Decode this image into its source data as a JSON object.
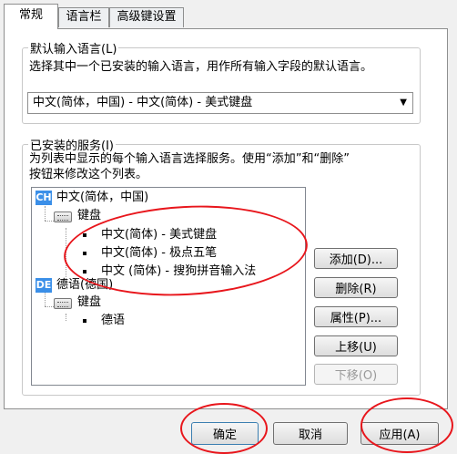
{
  "tabs": [
    {
      "label": "常规",
      "active": true
    },
    {
      "label": "语言栏",
      "active": false
    },
    {
      "label": "高级键设置",
      "active": false
    }
  ],
  "default_language": {
    "group_title": "默认输入语言(L)",
    "description": "选择其中一个已安装的输入语言，用作所有输入字段的默认语言。",
    "selected": "中文(简体，中国) - 中文(简体) - 美式键盘"
  },
  "installed_services": {
    "group_title": "已安装的服务(I)",
    "description_line1": "为列表中显示的每个输入语言选择服务。使用“添加”和“删除”",
    "description_line2": "按钮来修改这个列表。",
    "tree": {
      "lang1": {
        "badge": "CH",
        "label": "中文(简体，中国)"
      },
      "lang1_category": "键盘",
      "lang1_items": [
        "中文(简体) - 美式键盘",
        "中文(简体) - 极点五笔",
        "中文 (简体) - 搜狗拼音输入法"
      ],
      "lang2": {
        "badge": "DE",
        "label": "德语(德国)"
      },
      "lang2_category": "键盘",
      "lang2_items": [
        "德语"
      ]
    },
    "buttons": {
      "add": "添加(D)...",
      "remove": "删除(R)",
      "properties": "属性(P)...",
      "move_up": "上移(U)",
      "move_down": "下移(O)"
    }
  },
  "footer": {
    "ok": "确定",
    "cancel": "取消",
    "apply": "应用(A)"
  },
  "annotation_color": "#e8161c"
}
